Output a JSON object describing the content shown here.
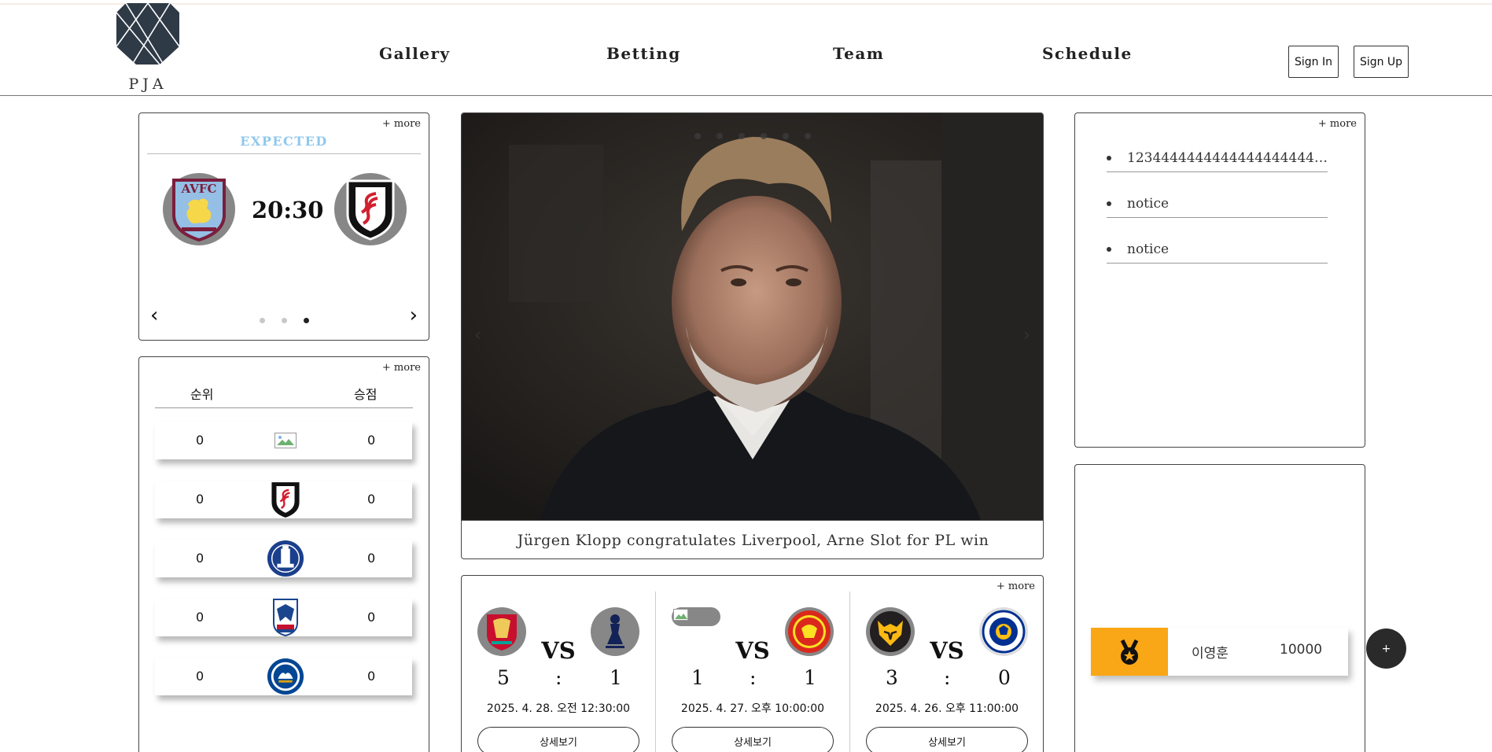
{
  "header": {
    "logo_text": "PJA",
    "nav": [
      "Gallery",
      "Betting",
      "Team",
      "Schedule"
    ],
    "sign_in": "Sign In",
    "sign_up": "Sign Up"
  },
  "expected": {
    "more": "+ more",
    "label": "EXPECTED",
    "time": "20:30",
    "home_crest_text": "AVFC",
    "slides": 3,
    "active_slide": 3
  },
  "ranking": {
    "more": "+ more",
    "headers": {
      "rank": "순위",
      "points": "승점"
    },
    "rows": [
      {
        "rank": "0",
        "points": "0",
        "crest": "broken-image"
      },
      {
        "rank": "0",
        "points": "0",
        "crest": "fulham-crest"
      },
      {
        "rank": "0",
        "points": "0",
        "crest": "everton-crest"
      },
      {
        "rank": "0",
        "points": "0",
        "crest": "crystal-palace-crest"
      },
      {
        "rank": "0",
        "points": "0",
        "crest": "chelsea-crest"
      }
    ]
  },
  "hero": {
    "caption": "Jürgen Klopp congratulates Liverpool, Arne Slot for PL win",
    "slides": 6
  },
  "results": {
    "more": "+ more",
    "vs_label": "VS",
    "separator": ":",
    "detail_label": "상세보기",
    "matches": [
      {
        "home": "liverpool",
        "away": "tottenham",
        "home_score": "5",
        "away_score": "1",
        "date": "2025. 4. 28. 오전 12:30:00"
      },
      {
        "home": "unknown",
        "away": "manchester-united",
        "home_score": "1",
        "away_score": "1",
        "date": "2025. 4. 27. 오후 10:00:00"
      },
      {
        "home": "wolves",
        "away": "leicester-city",
        "home_score": "3",
        "away_score": "0",
        "date": "2025. 4. 26. 오후 11:00:00"
      }
    ]
  },
  "notices": {
    "more": "+ more",
    "items": [
      "1234444444444444444444444444",
      "notice",
      "notice"
    ]
  },
  "user": {
    "name": "이영훈",
    "points": "10000",
    "fab": "+"
  },
  "colors": {
    "expected_label": "#8fc8ec",
    "medal_bg": "#f9a716",
    "crest_bg": "#878787",
    "fab_bg": "#2a2a2a"
  }
}
